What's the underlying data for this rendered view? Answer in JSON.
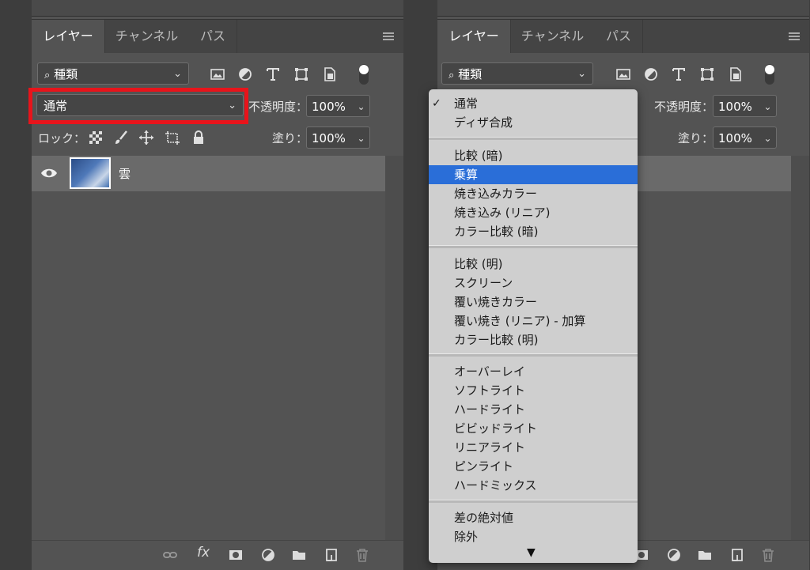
{
  "tabs": [
    "レイヤー",
    "チャンネル",
    "パス"
  ],
  "filter": {
    "label": "種類"
  },
  "blend": {
    "current": "通常"
  },
  "opacity": {
    "label": "不透明度：",
    "value": "100%"
  },
  "lock": {
    "label": "ロック："
  },
  "fill": {
    "label": "塗り：",
    "value": "100%"
  },
  "layer": {
    "name": "雲"
  },
  "menu": {
    "checkmark": "✓",
    "more_arrow": "▼",
    "groups": [
      [
        "通常",
        "ディザ合成"
      ],
      [
        "比較 (暗)",
        "乗算",
        "焼き込みカラー",
        "焼き込み (リニア)",
        "カラー比較 (暗)"
      ],
      [
        "比較 (明)",
        "スクリーン",
        "覆い焼きカラー",
        "覆い焼き (リニア) - 加算",
        "カラー比較 (明)"
      ],
      [
        "オーバーレイ",
        "ソフトライト",
        "ハードライト",
        "ビビッドライト",
        "リニアライト",
        "ピンライト",
        "ハードミックス"
      ],
      [
        "差の絶対値",
        "除外"
      ]
    ],
    "checked": "通常",
    "highlighted": "乗算"
  },
  "colors": {
    "highlight": "#2a6ed8",
    "red_box": "#e8141b"
  }
}
